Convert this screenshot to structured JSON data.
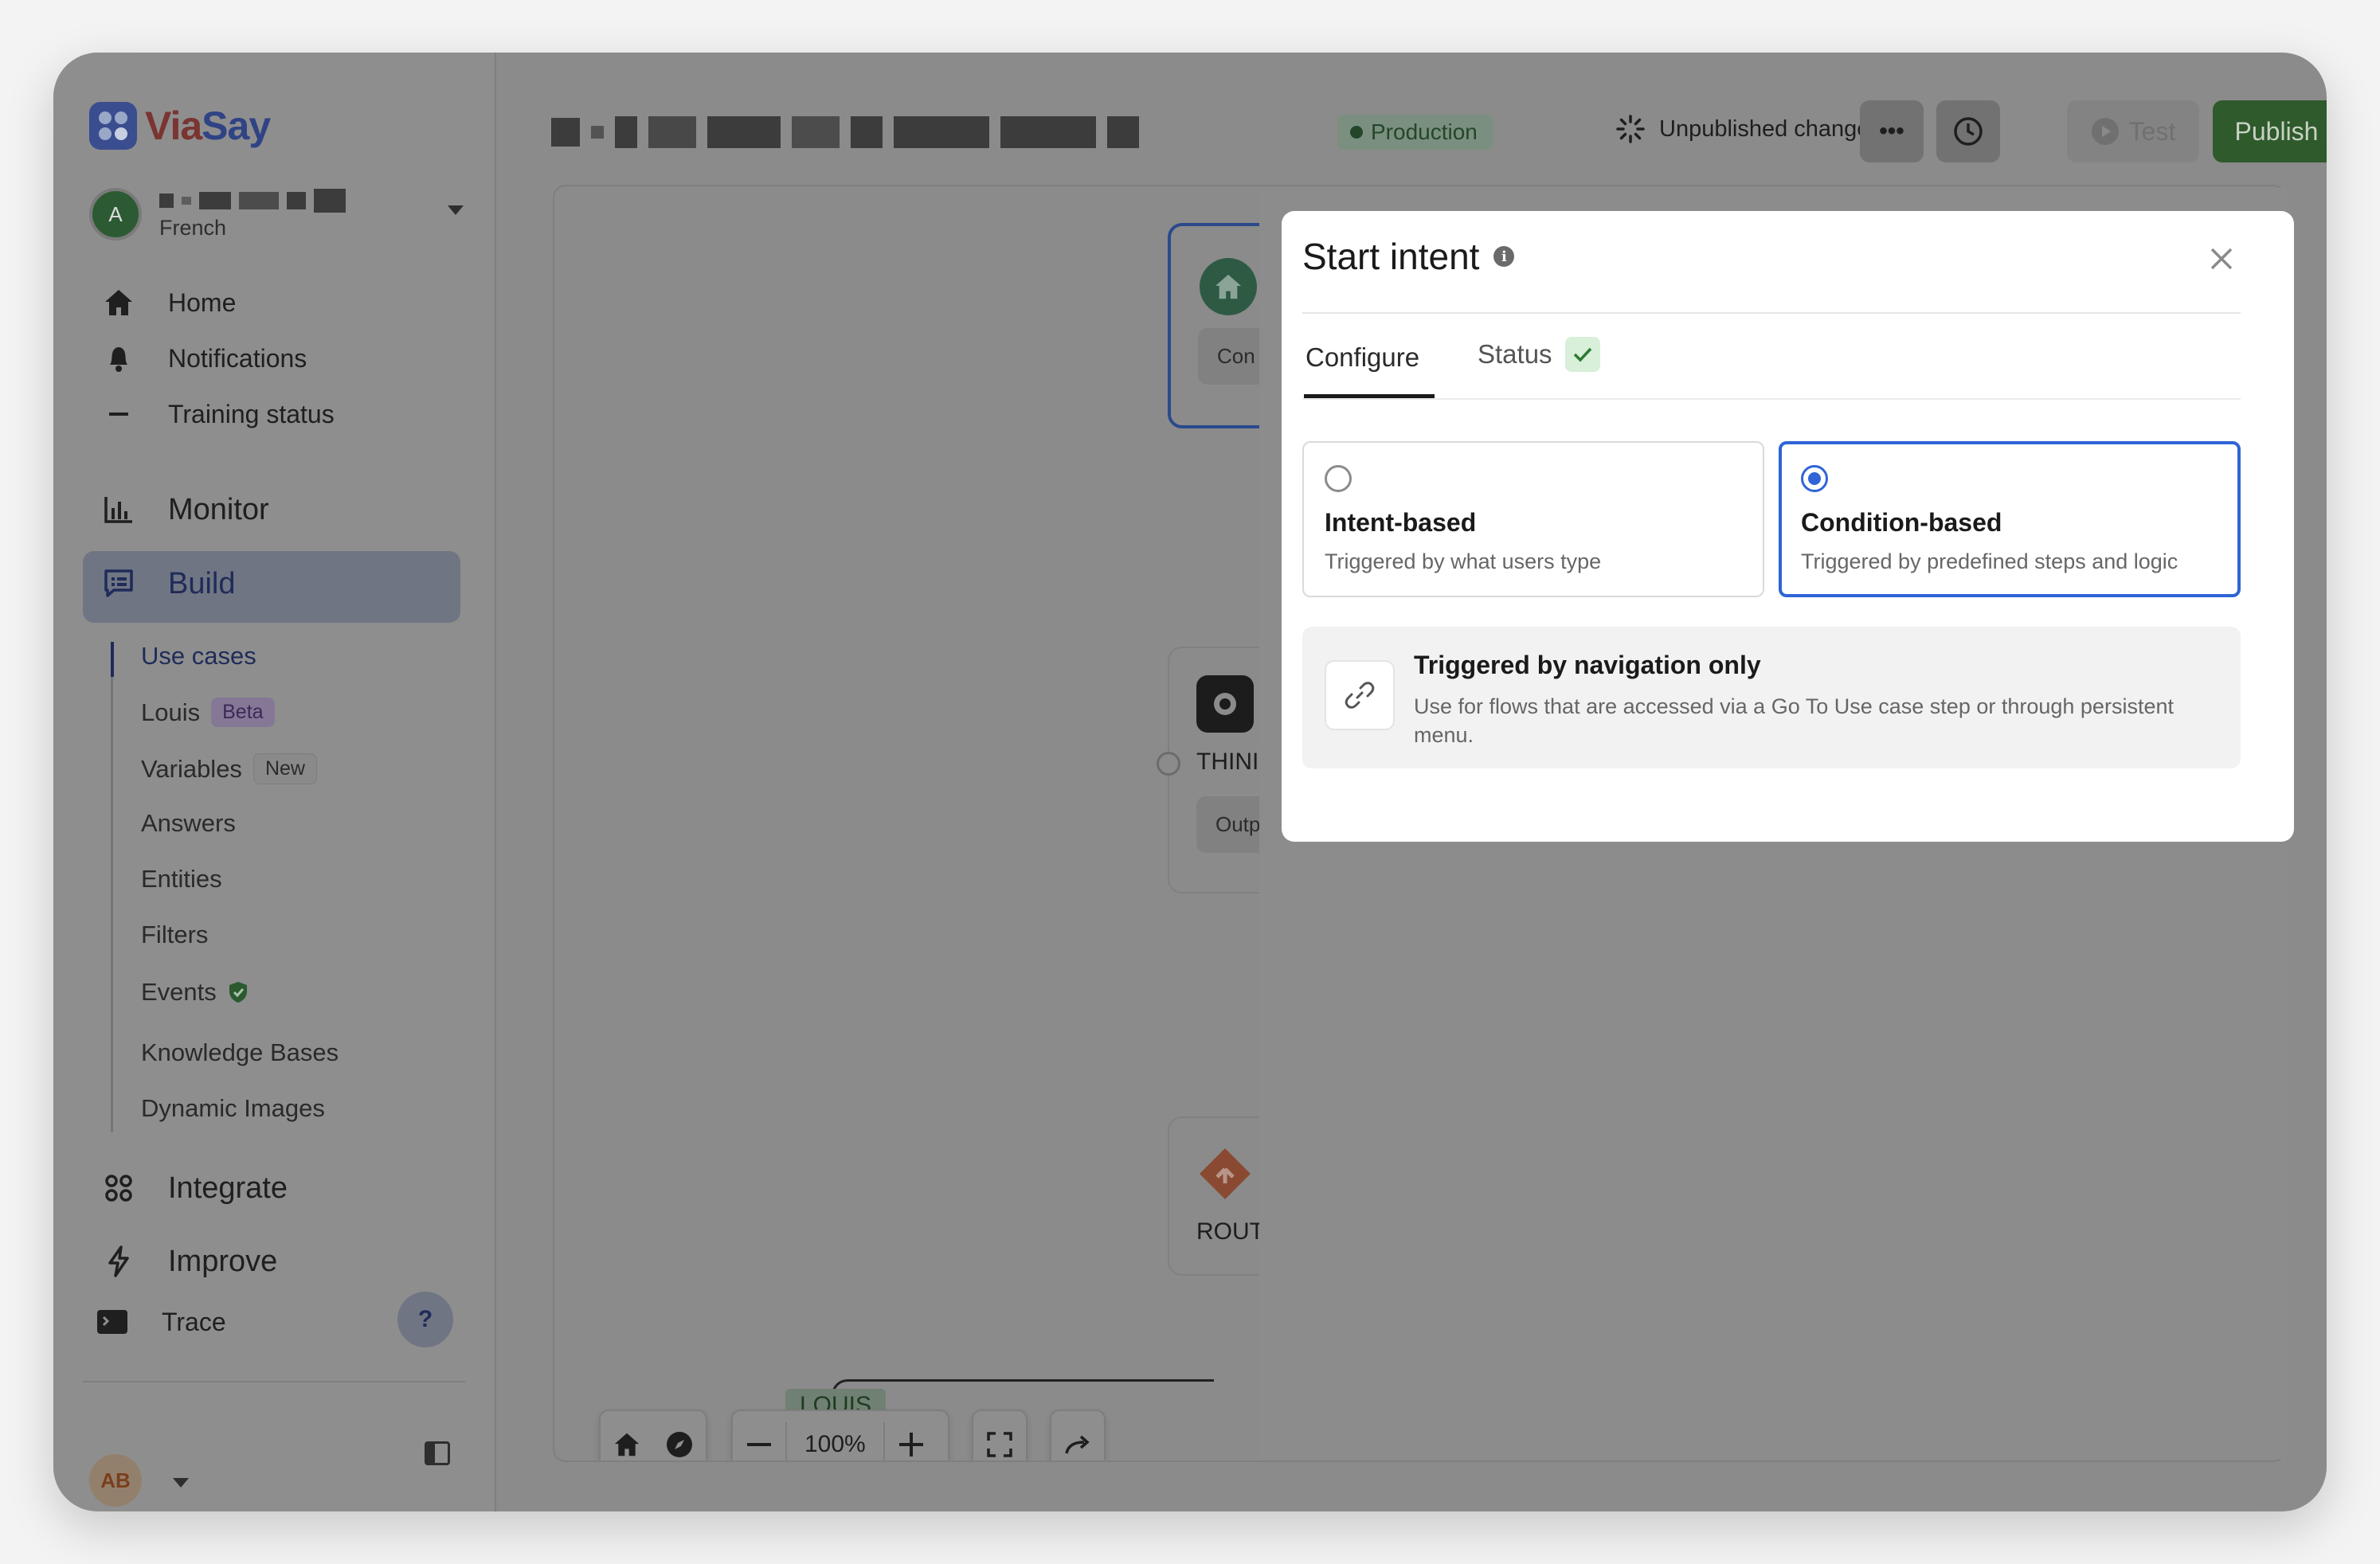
{
  "brand": {
    "name_part1": "Via",
    "name_part2": "Say"
  },
  "account": {
    "avatar_letter": "A",
    "language": "French"
  },
  "nav": {
    "home": "Home",
    "notifications": "Notifications",
    "training_status": "Training status",
    "monitor": "Monitor",
    "build": "Build",
    "integrate": "Integrate",
    "improve": "Improve",
    "trace": "Trace"
  },
  "build_sub": {
    "use_cases": "Use cases",
    "louis": "Louis",
    "louis_tag": "Beta",
    "variables": "Variables",
    "variables_tag": "New",
    "answers": "Answers",
    "entities": "Entities",
    "filters": "Filters",
    "events": "Events",
    "knowledge_bases": "Knowledge Bases",
    "dynamic_images": "Dynamic Images"
  },
  "help_label": "?",
  "user_initials": "AB",
  "topbar": {
    "environment_badge": "Production",
    "unpublished": "Unpublished changes",
    "more": "•••",
    "test": "Test",
    "publish": "Publish"
  },
  "canvas": {
    "node_start_inner": "Con",
    "node_think_label": "THINI",
    "node_think_inner": "Outp",
    "node_route_label": "ROUT",
    "edge_tag": "LOUIS",
    "zoom": "100%"
  },
  "modal": {
    "title": "Start intent",
    "info": "i",
    "tabs": {
      "configure": "Configure",
      "status": "Status"
    },
    "options": [
      {
        "title": "Intent-based",
        "desc": "Triggered by what users type",
        "selected": false
      },
      {
        "title": "Condition-based",
        "desc": "Triggered by predefined steps and logic",
        "selected": true
      }
    ],
    "nav_only": {
      "title": "Triggered by navigation only",
      "desc": "Use for flows that are accessed via a Go To Use case step or through persistent menu."
    }
  },
  "colors": {
    "accent_blue": "#2f64d6",
    "publish_green": "#2f5a2c",
    "status_check_bg": "#d8efd9"
  }
}
